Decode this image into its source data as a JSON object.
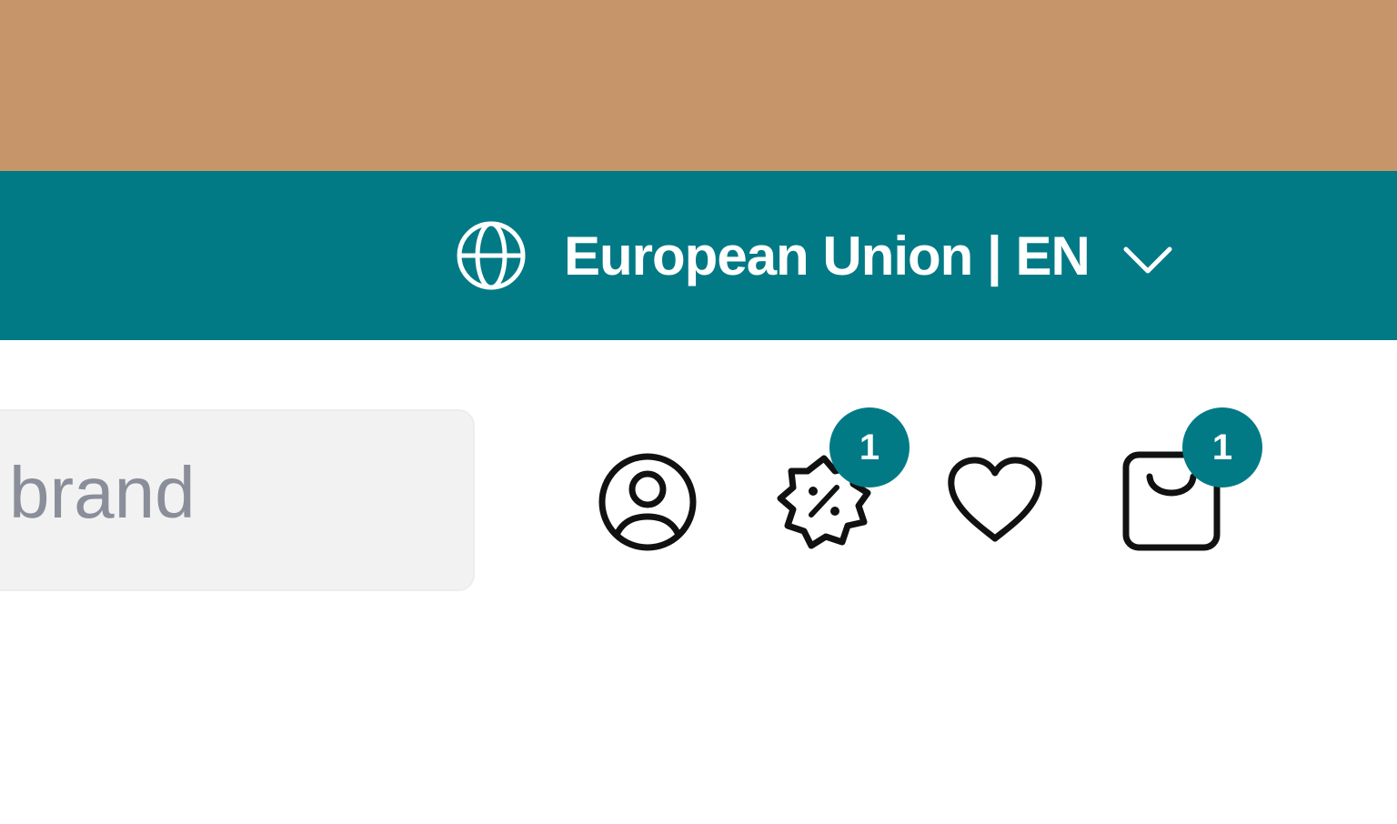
{
  "header": {
    "region_selector": {
      "label": "European Union | EN",
      "globe_icon": "globe-icon",
      "chevron_icon": "chevron-down-icon"
    },
    "search": {
      "visible_text": "brand"
    },
    "actions": {
      "account_icon": "user-circle-icon",
      "deals_icon": "discount-badge-icon",
      "deals_badge": "1",
      "wishlist_icon": "heart-icon",
      "cart_icon": "shopping-bag-icon",
      "cart_badge": "1"
    }
  },
  "colors": {
    "promo_bar": "#c7956a",
    "region_bar": "#027a86",
    "badge": "#027a86",
    "search_bg": "#f2f2f2"
  }
}
